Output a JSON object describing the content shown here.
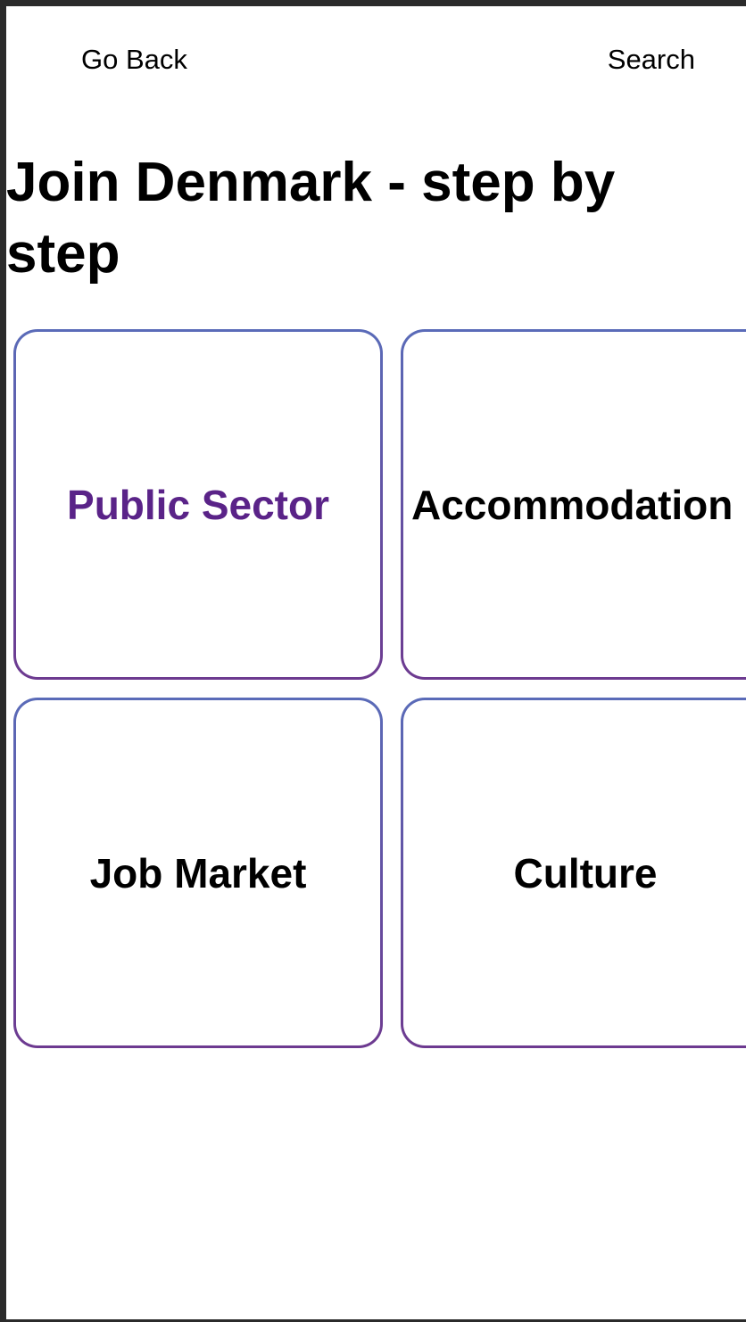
{
  "header": {
    "back_label": "Go Back",
    "search_label": "Search"
  },
  "page": {
    "title": "Join Denmark - step by step"
  },
  "categories": [
    {
      "label": "Public Sector",
      "active": true
    },
    {
      "label": "Accommodation",
      "active": false
    },
    {
      "label": "Job Market",
      "active": false
    },
    {
      "label": "Culture",
      "active": false
    }
  ],
  "colors": {
    "active_text": "#5a2388",
    "border_top": "#5a6bb8",
    "border_bottom": "#6d3a90",
    "frame": "#2b2b2b"
  }
}
